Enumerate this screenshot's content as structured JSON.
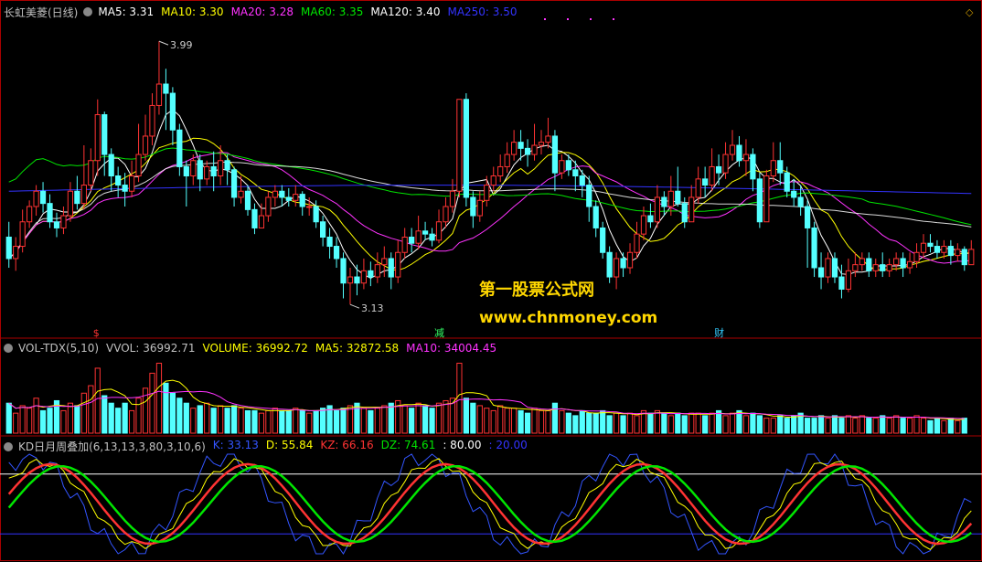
{
  "header": {
    "stock_name": "长虹美菱(日线)",
    "ma_items": [
      {
        "label": "MA5: 3.31",
        "color": "#ffffff"
      },
      {
        "label": "MA10: 3.30",
        "color": "#ffff00"
      },
      {
        "label": "MA20: 3.28",
        "color": "#ff33ff"
      },
      {
        "label": "MA60: 3.35",
        "color": "#00e600"
      },
      {
        "label": "MA120: 3.40",
        "color": "#ffffff"
      },
      {
        "label": "MA250: 3.50",
        "color": "#3333ff"
      }
    ]
  },
  "annotations": {
    "high_label": "3.99",
    "low_label": "3.13",
    "markers": [
      {
        "text": "$",
        "color": "#ff3333"
      },
      {
        "text": "减",
        "color": "#33ff66"
      },
      {
        "text": "财",
        "color": "#33ccff"
      }
    ]
  },
  "watermark": {
    "line1": "第一股票公式网",
    "line2": "www.chnmoney.com",
    "color": "#ffd700"
  },
  "vol_panel": {
    "items": [
      {
        "label": "VOL-TDX(5,10)",
        "color": "#c0c0c0"
      },
      {
        "label": "VVOL: 36992.71",
        "color": "#c0c0c0"
      },
      {
        "label": "VOLUME: 36992.72",
        "color": "#ffff00"
      },
      {
        "label": "MA5: 32872.58",
        "color": "#ffff00"
      },
      {
        "label": "MA10: 34004.45",
        "color": "#ff33ff"
      }
    ]
  },
  "kd_panel": {
    "items": [
      {
        "label": "KD日月周叠加(6,13,13,3,80,3,10,6)",
        "color": "#c0c0c0"
      },
      {
        "label": "K: 33.13",
        "color": "#3355ff"
      },
      {
        "label": "D: 55.84",
        "color": "#ffff00"
      },
      {
        "label": "KZ: 66.16",
        "color": "#ff3333"
      },
      {
        "label": "DZ: 74.61",
        "color": "#00e600"
      },
      {
        "label": ": 80.00",
        "color": "#ffffff"
      },
      {
        "label": ": 20.00",
        "color": "#3333ff"
      }
    ]
  },
  "colors": {
    "up": "#ff3333",
    "down": "#54ffff",
    "panel_border": "#aa0000",
    "ma5": "#ffffff",
    "ma10": "#ffff00",
    "ma20": "#ff33ff",
    "ma60": "#00e600",
    "ma120": "#ffffff",
    "ma250": "#3333ff"
  },
  "chart_data": {
    "type": "candlestick",
    "price_ylim": [
      3.05,
      4.05
    ],
    "candles": [
      [
        3.35,
        3.28,
        3.4,
        3.25
      ],
      [
        3.28,
        3.32,
        3.35,
        3.24
      ],
      [
        3.32,
        3.4,
        3.44,
        3.3
      ],
      [
        3.4,
        3.45,
        3.47,
        3.38
      ],
      [
        3.45,
        3.5,
        3.52,
        3.42
      ],
      [
        3.5,
        3.46,
        3.53,
        3.43
      ],
      [
        3.46,
        3.4,
        3.49,
        3.38
      ],
      [
        3.4,
        3.38,
        3.43,
        3.35
      ],
      [
        3.38,
        3.42,
        3.45,
        3.36
      ],
      [
        3.42,
        3.5,
        3.53,
        3.4
      ],
      [
        3.5,
        3.46,
        3.55,
        3.44
      ],
      [
        3.46,
        3.52,
        3.65,
        3.44
      ],
      [
        3.52,
        3.6,
        3.64,
        3.5
      ],
      [
        3.6,
        3.75,
        3.8,
        3.55
      ],
      [
        3.75,
        3.62,
        3.76,
        3.55
      ],
      [
        3.62,
        3.55,
        3.64,
        3.5
      ],
      [
        3.55,
        3.52,
        3.58,
        3.48
      ],
      [
        3.52,
        3.5,
        3.56,
        3.45
      ],
      [
        3.5,
        3.55,
        3.6,
        3.48
      ],
      [
        3.55,
        3.62,
        3.72,
        3.53
      ],
      [
        3.62,
        3.68,
        3.75,
        3.6
      ],
      [
        3.68,
        3.78,
        3.82,
        3.65
      ],
      [
        3.78,
        3.85,
        3.99,
        3.75
      ],
      [
        3.85,
        3.82,
        3.9,
        3.7
      ],
      [
        3.82,
        3.7,
        3.84,
        3.65
      ],
      [
        3.7,
        3.58,
        3.72,
        3.55
      ],
      [
        3.58,
        3.55,
        3.6,
        3.45
      ],
      [
        3.55,
        3.6,
        3.62,
        3.52
      ],
      [
        3.6,
        3.54,
        3.62,
        3.5
      ],
      [
        3.54,
        3.58,
        3.6,
        3.52
      ],
      [
        3.58,
        3.55,
        3.63,
        3.5
      ],
      [
        3.55,
        3.6,
        3.65,
        3.52
      ],
      [
        3.6,
        3.57,
        3.62,
        3.52
      ],
      [
        3.57,
        3.48,
        3.58,
        3.45
      ],
      [
        3.48,
        3.5,
        3.55,
        3.46
      ],
      [
        3.5,
        3.44,
        3.52,
        3.42
      ],
      [
        3.44,
        3.38,
        3.46,
        3.36
      ],
      [
        3.38,
        3.42,
        3.46,
        3.38
      ],
      [
        3.42,
        3.48,
        3.5,
        3.4
      ],
      [
        3.48,
        3.5,
        3.52,
        3.45
      ],
      [
        3.5,
        3.48,
        3.52,
        3.45
      ],
      [
        3.48,
        3.47,
        3.51,
        3.45
      ],
      [
        3.47,
        3.49,
        3.52,
        3.45
      ],
      [
        3.49,
        3.45,
        3.5,
        3.42
      ],
      [
        3.45,
        3.45,
        3.48,
        3.42
      ],
      [
        3.45,
        3.4,
        3.47,
        3.38
      ],
      [
        3.4,
        3.35,
        3.42,
        3.32
      ],
      [
        3.35,
        3.32,
        3.38,
        3.28
      ],
      [
        3.32,
        3.28,
        3.35,
        3.25
      ],
      [
        3.28,
        3.2,
        3.3,
        3.15
      ],
      [
        3.2,
        3.22,
        3.25,
        3.13
      ],
      [
        3.22,
        3.2,
        3.26,
        3.16
      ],
      [
        3.2,
        3.24,
        3.28,
        3.18
      ],
      [
        3.24,
        3.22,
        3.27,
        3.19
      ],
      [
        3.22,
        3.26,
        3.3,
        3.2
      ],
      [
        3.26,
        3.28,
        3.32,
        3.22
      ],
      [
        3.28,
        3.22,
        3.3,
        3.18
      ],
      [
        3.22,
        3.3,
        3.34,
        3.2
      ],
      [
        3.3,
        3.35,
        3.38,
        3.28
      ],
      [
        3.35,
        3.33,
        3.38,
        3.3
      ],
      [
        3.33,
        3.37,
        3.42,
        3.31
      ],
      [
        3.37,
        3.36,
        3.4,
        3.34
      ],
      [
        3.36,
        3.34,
        3.38,
        3.32
      ],
      [
        3.34,
        3.4,
        3.44,
        3.33
      ],
      [
        3.4,
        3.45,
        3.48,
        3.38
      ],
      [
        3.45,
        3.5,
        3.54,
        3.43
      ],
      [
        3.5,
        3.8,
        3.8,
        3.48
      ],
      [
        3.8,
        3.48,
        3.82,
        3.45
      ],
      [
        3.48,
        3.42,
        3.5,
        3.38
      ],
      [
        3.42,
        3.47,
        3.5,
        3.4
      ],
      [
        3.47,
        3.52,
        3.55,
        3.45
      ],
      [
        3.52,
        3.55,
        3.58,
        3.5
      ],
      [
        3.55,
        3.58,
        3.62,
        3.53
      ],
      [
        3.58,
        3.62,
        3.66,
        3.56
      ],
      [
        3.62,
        3.66,
        3.7,
        3.6
      ],
      [
        3.66,
        3.64,
        3.7,
        3.6
      ],
      [
        3.64,
        3.62,
        3.67,
        3.58
      ],
      [
        3.62,
        3.65,
        3.72,
        3.6
      ],
      [
        3.65,
        3.66,
        3.7,
        3.62
      ],
      [
        3.66,
        3.68,
        3.74,
        3.64
      ],
      [
        3.68,
        3.56,
        3.7,
        3.5
      ],
      [
        3.56,
        3.6,
        3.62,
        3.54
      ],
      [
        3.6,
        3.57,
        3.62,
        3.55
      ],
      [
        3.57,
        3.55,
        3.6,
        3.5
      ],
      [
        3.55,
        3.52,
        3.57,
        3.48
      ],
      [
        3.52,
        3.45,
        3.55,
        3.4
      ],
      [
        3.45,
        3.38,
        3.47,
        3.35
      ],
      [
        3.38,
        3.3,
        3.4,
        3.28
      ],
      [
        3.3,
        3.22,
        3.32,
        3.2
      ],
      [
        3.22,
        3.28,
        3.3,
        3.18
      ],
      [
        3.28,
        3.25,
        3.3,
        3.22
      ],
      [
        3.25,
        3.3,
        3.33,
        3.23
      ],
      [
        3.3,
        3.36,
        3.4,
        3.28
      ],
      [
        3.36,
        3.42,
        3.45,
        3.34
      ],
      [
        3.42,
        3.4,
        3.46,
        3.38
      ],
      [
        3.4,
        3.48,
        3.52,
        3.38
      ],
      [
        3.48,
        3.45,
        3.5,
        3.42
      ],
      [
        3.45,
        3.5,
        3.55,
        3.42
      ],
      [
        3.5,
        3.46,
        3.58,
        3.45
      ],
      [
        3.46,
        3.4,
        3.48,
        3.38
      ],
      [
        3.4,
        3.48,
        3.52,
        3.4
      ],
      [
        3.48,
        3.54,
        3.58,
        3.46
      ],
      [
        3.54,
        3.52,
        3.58,
        3.48
      ],
      [
        3.52,
        3.58,
        3.64,
        3.5
      ],
      [
        3.58,
        3.56,
        3.62,
        3.52
      ],
      [
        3.56,
        3.62,
        3.66,
        3.54
      ],
      [
        3.62,
        3.65,
        3.7,
        3.6
      ],
      [
        3.65,
        3.6,
        3.68,
        3.58
      ],
      [
        3.6,
        3.62,
        3.67,
        3.55
      ],
      [
        3.62,
        3.54,
        3.64,
        3.5
      ],
      [
        3.54,
        3.4,
        3.56,
        3.38
      ],
      [
        3.4,
        3.55,
        3.57,
        3.4
      ],
      [
        3.55,
        3.6,
        3.66,
        3.53
      ],
      [
        3.6,
        3.56,
        3.66,
        3.52
      ],
      [
        3.56,
        3.5,
        3.58,
        3.48
      ],
      [
        3.5,
        3.48,
        3.54,
        3.45
      ],
      [
        3.48,
        3.45,
        3.52,
        3.42
      ],
      [
        3.45,
        3.38,
        3.47,
        3.25
      ],
      [
        3.38,
        3.25,
        3.4,
        3.22
      ],
      [
        3.25,
        3.22,
        3.3,
        3.18
      ],
      [
        3.22,
        3.28,
        3.3,
        3.2
      ],
      [
        3.28,
        3.22,
        3.3,
        3.2
      ],
      [
        3.22,
        3.18,
        3.26,
        3.15
      ],
      [
        3.18,
        3.24,
        3.28,
        3.17
      ],
      [
        3.24,
        3.26,
        3.3,
        3.22
      ],
      [
        3.26,
        3.28,
        3.3,
        3.24
      ],
      [
        3.28,
        3.24,
        3.3,
        3.22
      ],
      [
        3.24,
        3.26,
        3.28,
        3.22
      ],
      [
        3.26,
        3.24,
        3.3,
        3.22
      ],
      [
        3.24,
        3.26,
        3.28,
        3.22
      ],
      [
        3.26,
        3.28,
        3.3,
        3.24
      ],
      [
        3.28,
        3.25,
        3.3,
        3.22
      ],
      [
        3.25,
        3.27,
        3.3,
        3.23
      ],
      [
        3.27,
        3.3,
        3.33,
        3.25
      ],
      [
        3.3,
        3.33,
        3.36,
        3.28
      ],
      [
        3.33,
        3.32,
        3.36,
        3.3
      ],
      [
        3.32,
        3.3,
        3.34,
        3.28
      ],
      [
        3.3,
        3.32,
        3.34,
        3.28
      ],
      [
        3.32,
        3.29,
        3.34,
        3.26
      ],
      [
        3.29,
        3.31,
        3.33,
        3.27
      ],
      [
        3.31,
        3.26,
        3.32,
        3.24
      ],
      [
        3.26,
        3.31,
        3.34,
        3.26
      ]
    ],
    "volume": [
      12,
      8,
      11,
      10,
      14,
      9,
      10,
      13,
      9,
      12,
      11,
      16,
      19,
      26,
      15,
      12,
      10,
      12,
      9,
      14,
      18,
      24,
      28,
      20,
      16,
      14,
      12,
      10,
      11,
      12,
      10,
      11,
      10,
      11,
      10,
      9,
      9,
      8,
      9,
      10,
      9,
      9,
      10,
      9,
      8,
      9,
      10,
      11,
      9,
      10,
      11,
      12,
      10,
      9,
      10,
      11,
      12,
      13,
      11,
      10,
      12,
      11,
      10,
      12,
      13,
      14,
      28,
      14,
      12,
      11,
      10,
      9,
      11,
      10,
      10,
      9,
      8,
      10,
      9,
      9,
      12,
      9,
      8,
      7,
      9,
      8,
      8,
      9,
      7,
      8,
      7,
      8,
      7,
      9,
      8,
      9,
      8,
      7,
      8,
      7,
      8,
      8,
      7,
      8,
      9,
      7,
      8,
      9,
      7,
      8,
      7,
      6,
      6,
      7,
      6,
      7,
      8,
      6,
      6,
      7,
      6,
      7,
      6,
      7,
      6,
      7,
      6,
      6,
      7,
      6,
      7,
      6,
      6,
      7,
      6,
      5,
      6,
      5,
      6,
      5,
      6
    ],
    "kd_range": [
      0,
      100
    ]
  }
}
